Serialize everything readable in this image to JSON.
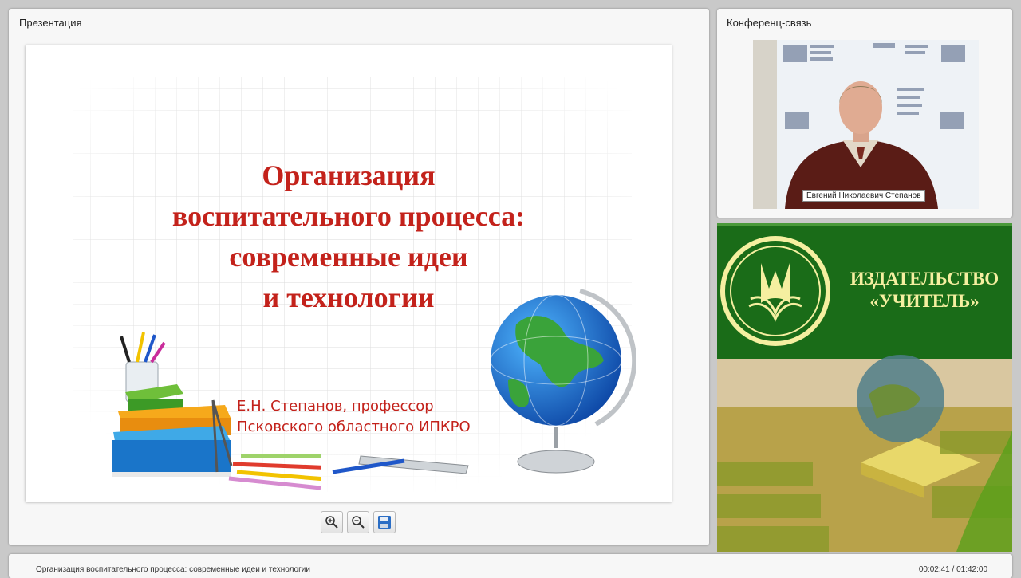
{
  "presentation_panel": {
    "title": "Презентация"
  },
  "slide": {
    "title_lines": [
      "Организация",
      "воспитательного процесса:",
      "современные идеи",
      "и технологии"
    ],
    "author_lines": [
      "Е.Н. Степанов, профессор",
      "Псковского областного ИПКРО"
    ]
  },
  "toolbar": {
    "zoom_in_icon": "zoom-in-icon",
    "zoom_out_icon": "zoom-out-icon",
    "save_icon": "save-icon"
  },
  "conference_panel": {
    "title": "Конференц-связь",
    "presenter_name": "Евгений Николаевич Степанов"
  },
  "ad": {
    "publisher_lines": [
      "ИЗДАТЕЛЬСТВО",
      "«УЧИТЕЛЬ»"
    ]
  },
  "status_bar": {
    "title": "Организация воспитательного процесса: современные идеи и технологии",
    "time": "00:02:41 / 01:42:00"
  },
  "colors": {
    "slide_title": "#c3221b",
    "ad_green": "#1f6a1a",
    "ad_text": "#f5efa0"
  }
}
